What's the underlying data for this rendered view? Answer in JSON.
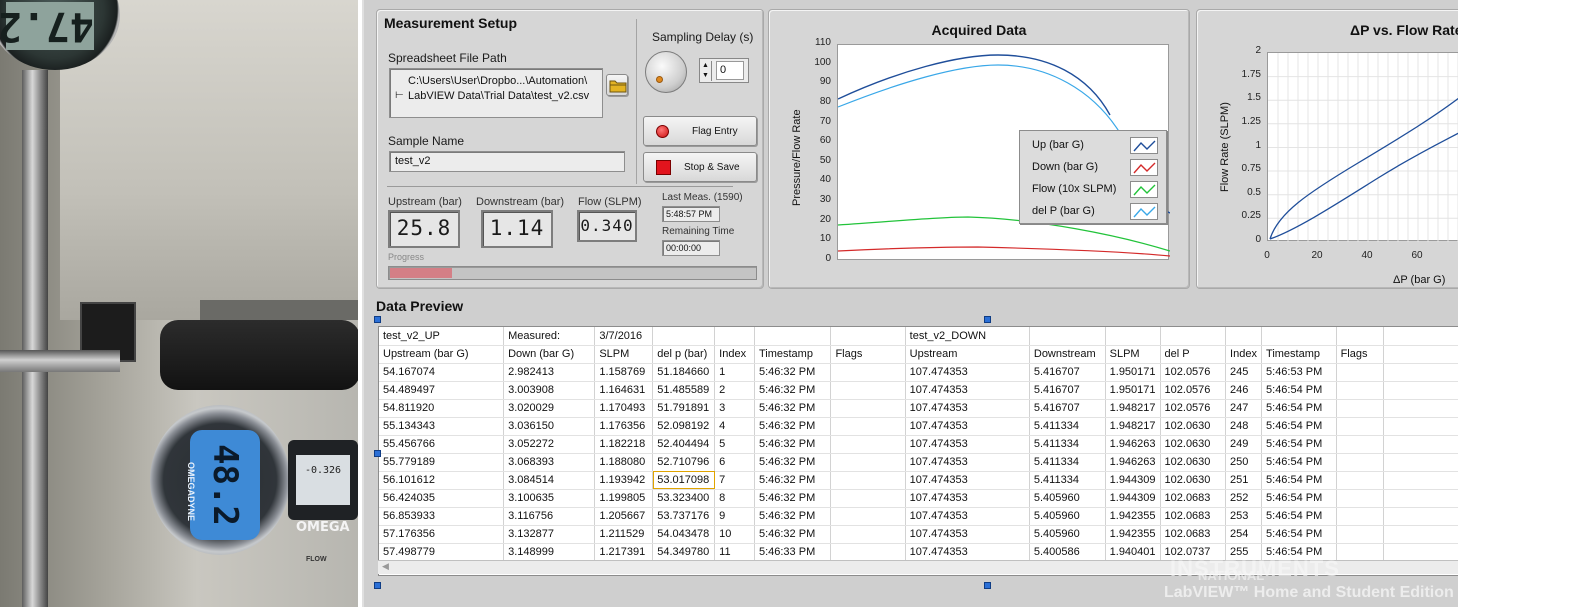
{
  "photo": {
    "top_gauge_reading": "47.2",
    "meter_reading": "48.2",
    "meter_brand": "OMEGADYNE",
    "brand_logo": "OMEGA",
    "side_meter_reading": "-0.326",
    "flow_label": "FLOW"
  },
  "setup": {
    "title": "Measurement Setup",
    "file_path_label": "Spreadsheet File Path",
    "file_path_value_line1": "C:\\Users\\User\\Dropbo...\\Automation\\",
    "file_path_value_line2": "LabVIEW Data\\Trial Data\\test_v2.csv",
    "browse_icon": "folder-icon",
    "sampling_delay_label": "Sampling Delay (s)",
    "sampling_delay_value": "0",
    "flag_entry_label": "Flag Entry",
    "stop_save_label": "Stop & Save",
    "sample_name_label": "Sample Name",
    "sample_name_value": "test_v2",
    "upstream_label": "Upstream (bar)",
    "upstream_value": "25.8",
    "downstream_label": "Downstream (bar)",
    "downstream_value": "1.14",
    "flow_label": "Flow (SLPM)",
    "flow_value": "0.340",
    "last_meas_label": "Last Meas. (1590)",
    "last_meas_value": "5:48:57 PM",
    "remaining_label": "Remaining Time",
    "remaining_value": "00:00:00",
    "progress_label": "Progress",
    "progress_fraction": 0.17
  },
  "acquired": {
    "title": "Acquired Data",
    "ylabel": "Pressure/Flow Rate",
    "y_ticks": [
      "110",
      "100",
      "90",
      "80",
      "70",
      "60",
      "50",
      "40",
      "30",
      "20",
      "10",
      "0"
    ],
    "legend": [
      {
        "label": "Up (bar G)",
        "color": "#1f4e9a"
      },
      {
        "label": "Down (bar G)",
        "color": "#d42a2a"
      },
      {
        "label": "Flow (10x SLPM)",
        "color": "#22c33a"
      },
      {
        "label": "del P (bar G)",
        "color": "#3aa8e8"
      }
    ]
  },
  "dp_chart": {
    "title": "ΔP vs. Flow Rate",
    "ylabel": "Flow Rate (SLPM)",
    "xlabel": "ΔP (bar G)",
    "y_ticks": [
      "2",
      "1.75",
      "1.5",
      "1.25",
      "1",
      "0.75",
      "0.5",
      "0.25",
      "0"
    ],
    "x_ticks": [
      "0",
      "20",
      "40",
      "60"
    ]
  },
  "preview": {
    "title": "Data Preview",
    "rows": [
      [
        "test_v2_UP",
        "Measured:",
        "3/7/2016",
        "",
        "",
        "",
        "",
        "test_v2_DOWN",
        "",
        "",
        "",
        "",
        "",
        "",
        ""
      ],
      [
        "Upstream (bar G)",
        "Down (bar G)",
        "SLPM",
        "del p (bar)",
        "Index",
        "Timestamp",
        "Flags",
        "Upstream",
        "Downstream",
        "SLPM",
        "del P",
        "Index",
        "Timestamp",
        "Flags",
        ""
      ],
      [
        "54.167074",
        "2.982413",
        "1.158769",
        "51.184660",
        "1",
        "5:46:32 PM",
        "",
        "107.474353",
        "5.416707",
        "1.950171",
        "102.0576",
        "245",
        "5:46:53 PM",
        "",
        ""
      ],
      [
        "54.489497",
        "3.003908",
        "1.164631",
        "51.485589",
        "2",
        "5:46:32 PM",
        "",
        "107.474353",
        "5.416707",
        "1.950171",
        "102.0576",
        "246",
        "5:46:54 PM",
        "",
        ""
      ],
      [
        "54.811920",
        "3.020029",
        "1.170493",
        "51.791891",
        "3",
        "5:46:32 PM",
        "",
        "107.474353",
        "5.416707",
        "1.948217",
        "102.0576",
        "247",
        "5:46:54 PM",
        "",
        ""
      ],
      [
        "55.134343",
        "3.036150",
        "1.176356",
        "52.098192",
        "4",
        "5:46:32 PM",
        "",
        "107.474353",
        "5.411334",
        "1.948217",
        "102.0630",
        "248",
        "5:46:54 PM",
        "",
        ""
      ],
      [
        "55.456766",
        "3.052272",
        "1.182218",
        "52.404494",
        "5",
        "5:46:32 PM",
        "",
        "107.474353",
        "5.411334",
        "1.946263",
        "102.0630",
        "249",
        "5:46:54 PM",
        "",
        ""
      ],
      [
        "55.779189",
        "3.068393",
        "1.188080",
        "52.710796",
        "6",
        "5:46:32 PM",
        "",
        "107.474353",
        "5.411334",
        "1.946263",
        "102.0630",
        "250",
        "5:46:54 PM",
        "",
        ""
      ],
      [
        "56.101612",
        "3.084514",
        "1.193942",
        "53.017098",
        "7",
        "5:46:32 PM",
        "",
        "107.474353",
        "5.411334",
        "1.944309",
        "102.0630",
        "251",
        "5:46:54 PM",
        "",
        ""
      ],
      [
        "56.424035",
        "3.100635",
        "1.199805",
        "53.323400",
        "8",
        "5:46:32 PM",
        "",
        "107.474353",
        "5.405960",
        "1.944309",
        "102.0683",
        "252",
        "5:46:54 PM",
        "",
        ""
      ],
      [
        "56.853933",
        "3.116756",
        "1.205667",
        "53.737176",
        "9",
        "5:46:32 PM",
        "",
        "107.474353",
        "5.405960",
        "1.942355",
        "102.0683",
        "253",
        "5:46:54 PM",
        "",
        ""
      ],
      [
        "57.176356",
        "3.132877",
        "1.211529",
        "54.043478",
        "10",
        "5:46:32 PM",
        "",
        "107.474353",
        "5.405960",
        "1.942355",
        "102.0683",
        "254",
        "5:46:54 PM",
        "",
        ""
      ],
      [
        "57.498779",
        "3.148999",
        "1.217391",
        "54.349780",
        "11",
        "5:46:33 PM",
        "",
        "107.474353",
        "5.400586",
        "1.940401",
        "102.0737",
        "255",
        "5:46:54 PM",
        "",
        ""
      ]
    ],
    "selected_cell": [
      8,
      3
    ]
  },
  "watermark": {
    "line1": "NATIONAL",
    "line2": "INSTRUMENTS",
    "line3": "LabVIEW™ Home and Student Edition"
  }
}
